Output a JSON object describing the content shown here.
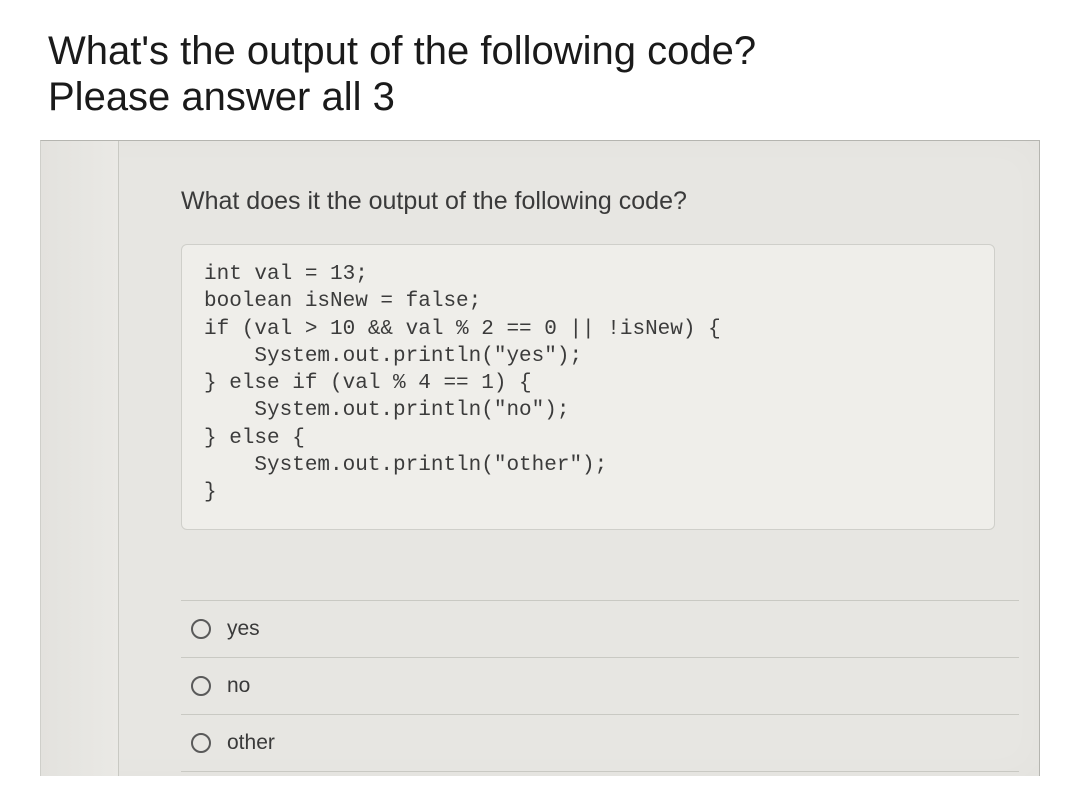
{
  "title": {
    "line1": "What's the output of the following code?",
    "line2": "Please answer all 3"
  },
  "question": {
    "prompt": "What does it the output of the following code?",
    "code": "int val = 13;\nboolean isNew = false;\nif (val > 10 && val % 2 == 0 || !isNew) {\n    System.out.println(\"yes\");\n} else if (val % 4 == 1) {\n    System.out.println(\"no\");\n} else {\n    System.out.println(\"other\");\n}"
  },
  "options": [
    {
      "label": "yes"
    },
    {
      "label": "no"
    },
    {
      "label": "other"
    }
  ]
}
